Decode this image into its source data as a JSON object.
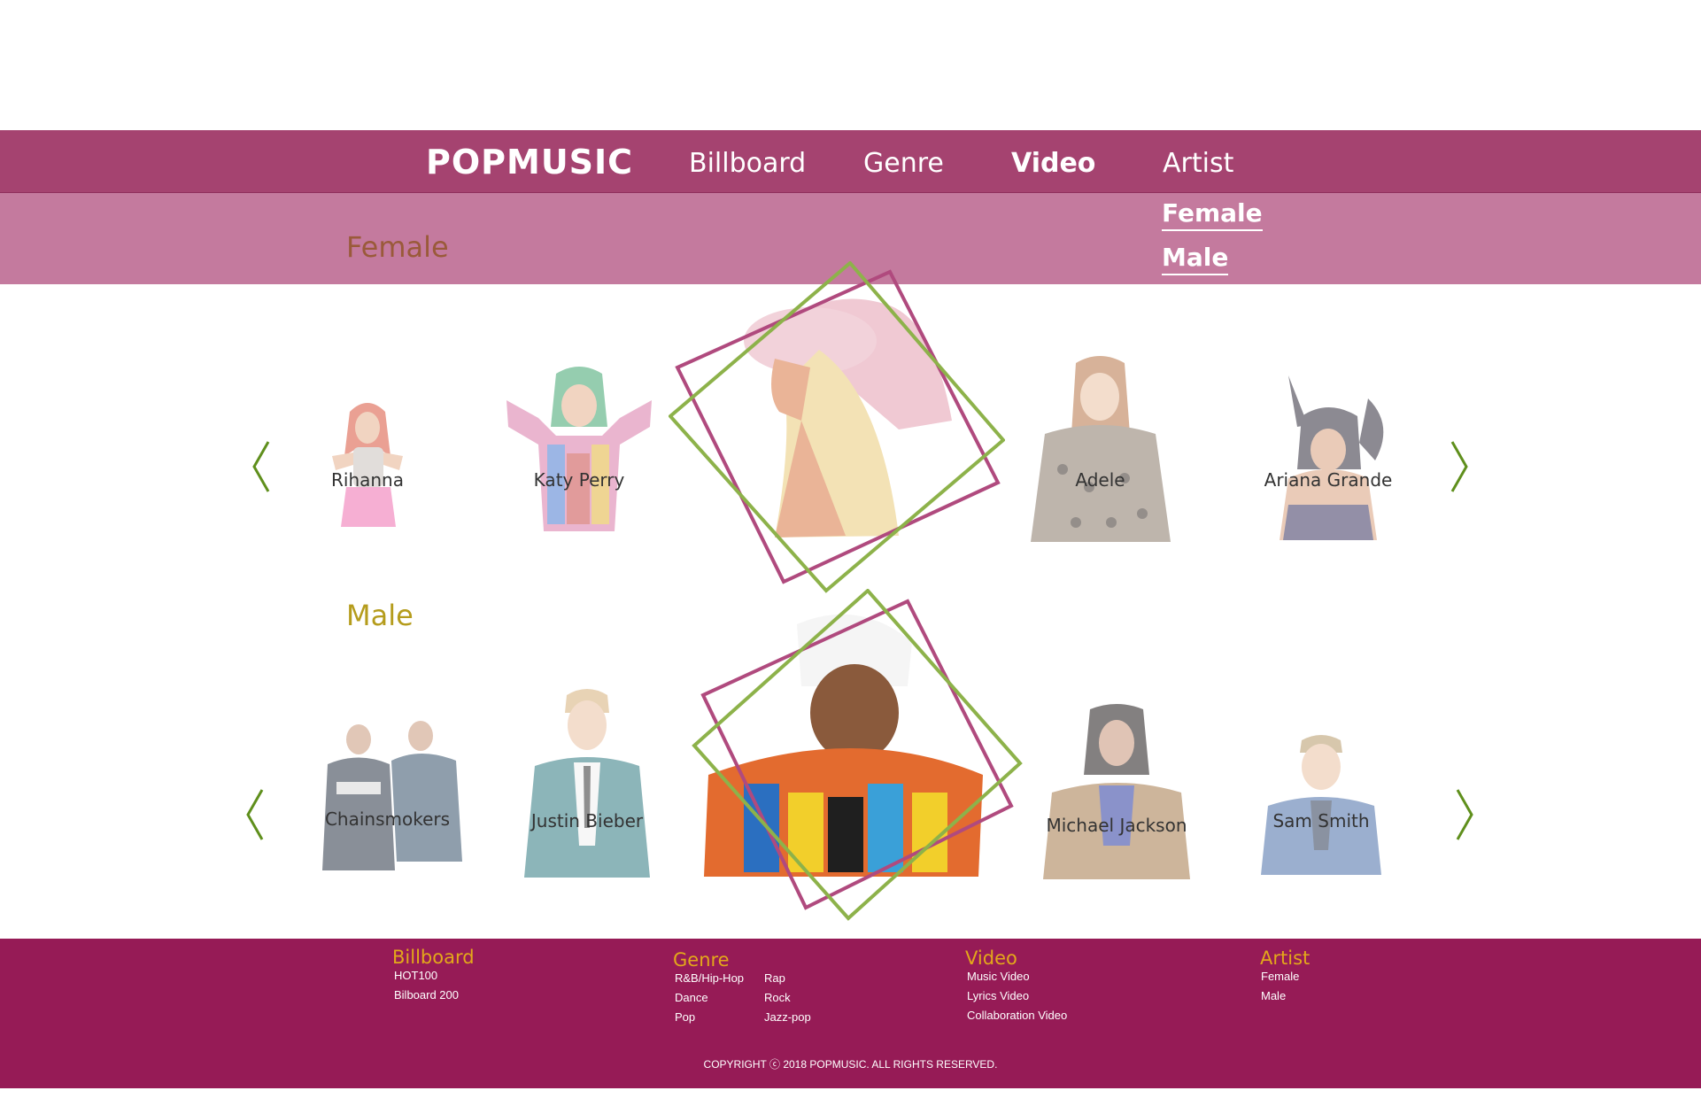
{
  "nav": {
    "logo": "POPMUSIC",
    "items": [
      {
        "label": "Billboard"
      },
      {
        "label": "Genre"
      },
      {
        "label": "Video"
      },
      {
        "label": "Artist"
      }
    ]
  },
  "subnav": {
    "title": "Female",
    "links": [
      {
        "label": "Female"
      },
      {
        "label": "Male"
      }
    ]
  },
  "female": {
    "title": "Female",
    "artists": [
      {
        "name": "Rihanna"
      },
      {
        "name": "Katy Perry"
      },
      {
        "name": "Adele"
      },
      {
        "name": "Ariana Grande"
      }
    ],
    "featured_icon": "artist-photo-hat-profile"
  },
  "male": {
    "title": "Male",
    "artists": [
      {
        "name": "Chainsmokers"
      },
      {
        "name": "Justin Bieber"
      },
      {
        "name": "Michael Jackson"
      },
      {
        "name": "Sam Smith"
      }
    ],
    "featured_icon": "artist-photo-cap"
  },
  "arrows": {
    "prev_icon": "chevron-left-icon",
    "next_icon": "chevron-right-icon"
  },
  "colors": {
    "nav_bg": "#a54370",
    "subnav_bg": "#c47a9e",
    "footer_bg": "#961b56",
    "footer_heading": "#e3a81a",
    "frame_green": "#8db24a",
    "frame_pink": "#b04a7e",
    "female_title": "#9a5a3a",
    "male_title": "#b59c1c"
  },
  "footer": {
    "columns": [
      {
        "heading": "Billboard",
        "links": [
          "HOT100",
          "Bilboard 200"
        ]
      },
      {
        "heading": "Genre",
        "links": [
          "R&B/Hip-Hop",
          "Dance",
          "Pop",
          "Rap",
          "Rock",
          "Jazz-pop"
        ]
      },
      {
        "heading": "Video",
        "links": [
          "Music Video",
          "Lyrics Video",
          "Collaboration Video"
        ]
      },
      {
        "heading": "Artist",
        "links": [
          "Female",
          "Male"
        ]
      }
    ],
    "copyright": "COPYRIGHT ⓒ 2018 POPMUSIC. ALL RIGHTS RESERVED."
  }
}
